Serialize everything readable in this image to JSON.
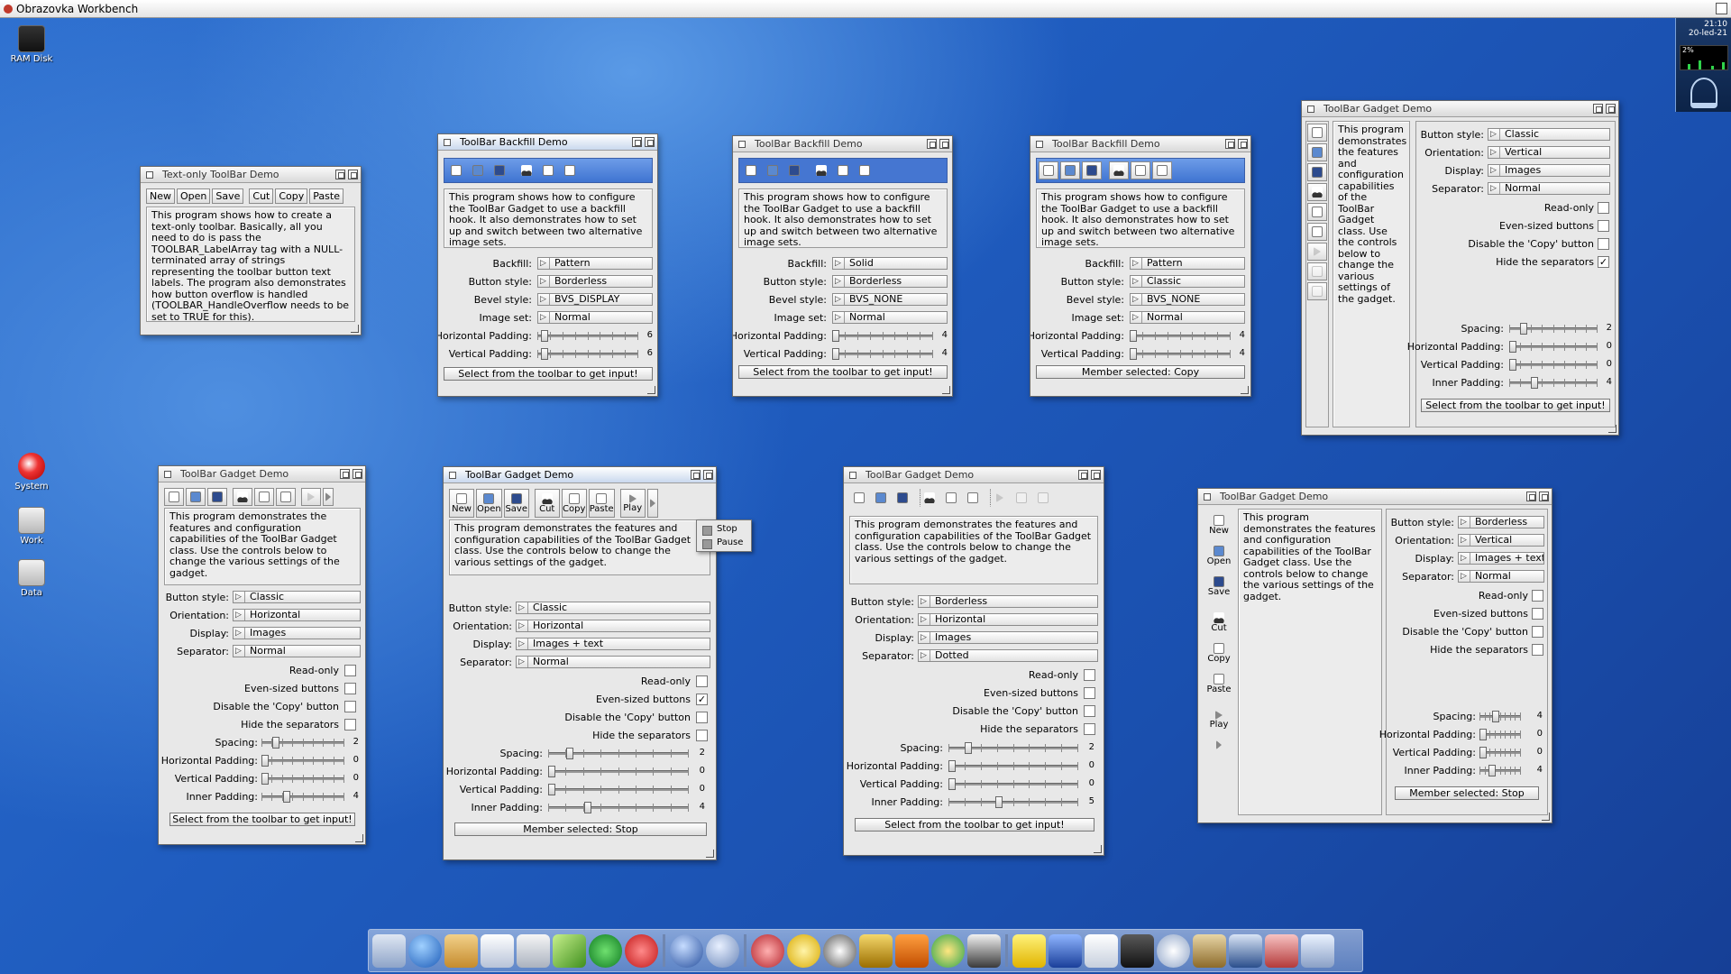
{
  "screen": {
    "title": "Obrazovka Workbench"
  },
  "desktop_icons": [
    "RAM Disk",
    "System",
    "Work",
    "Data"
  ],
  "clock": {
    "time": "21:10",
    "date": "20-led-21",
    "cpu": "2%"
  },
  "colors": {
    "accent": "#4576d1",
    "desktop": "#1f5cbf",
    "window_bg": "#e8e8e8"
  },
  "common": {
    "button_style": "Button style:",
    "orientation": "Orientation:",
    "display": "Display:",
    "separator": "Separator:",
    "read_only": "Read-only",
    "even_sized": "Even-sized buttons",
    "disable_copy": "Disable the 'Copy' button",
    "hide_separators": "Hide the separators",
    "spacing": "Spacing:",
    "hpad": "Horizontal Padding:",
    "vpad": "Vertical Padding:",
    "inner": "Inner Padding:",
    "backfill": "Backfill:",
    "bevel": "Bevel style:",
    "imageset": "Image set:",
    "select_prompt": "Select from the toolbar to get input!",
    "gadget_desc_long": "This program demonstrates the features and configuration capabilities of the ToolBar Gadget class. Use the controls below to change the various settings of the gadget.",
    "backfill_desc": "This program shows how to configure the ToolBar Gadget to use a backfill hook. It also demonstrates how to set up and switch between two alternative image sets."
  },
  "w1": {
    "title": "Text-only ToolBar Demo",
    "buttons": [
      "New",
      "Open",
      "Save",
      "Cut",
      "Copy",
      "Paste"
    ],
    "desc": "This program shows how to create a text-only toolbar. Basically, all you need to do is pass the TOOLBAR_LabelArray tag with a NULL-terminated array of strings representing the toolbar button text labels. The program also demonstrates how button overflow is handled (TOOLBAR_HandleOverflow needs to be set to TRUE for this)."
  },
  "w2": {
    "title": "ToolBar Backfill Demo",
    "backfill": "Pattern",
    "button_style": "Borderless",
    "bevel": "BVS_DISPLAY",
    "imageset": "Normal",
    "hpad": "6",
    "vpad": "6",
    "status": "Select from the toolbar to get input!"
  },
  "w3": {
    "title": "ToolBar Backfill Demo",
    "backfill": "Solid",
    "button_style": "Borderless",
    "bevel": "BVS_NONE",
    "imageset": "Normal",
    "hpad": "4",
    "vpad": "4",
    "status": "Select from the toolbar to get input!"
  },
  "w4": {
    "title": "ToolBar Backfill Demo",
    "backfill": "Pattern",
    "button_style": "Classic",
    "bevel": "BVS_NONE",
    "imageset": "Normal",
    "hpad": "4",
    "vpad": "4",
    "status": "Member selected: Copy"
  },
  "w5": {
    "title": "ToolBar Gadget Demo",
    "button_style": "Classic",
    "orientation": "Vertical",
    "display": "Images",
    "separator": "Normal",
    "spacing": "2",
    "hpad": "0",
    "vpad": "0",
    "inner": "4",
    "status": "Select from the toolbar to get input!"
  },
  "w6": {
    "title": "ToolBar Gadget Demo",
    "button_style": "Classic",
    "orientation": "Horizontal",
    "display": "Images",
    "separator": "Normal",
    "spacing": "2",
    "hpad": "0",
    "vpad": "0",
    "inner": "4",
    "status": "Select from the toolbar to get input!"
  },
  "w7": {
    "title": "ToolBar Gadget Demo",
    "buttons": [
      "New",
      "Open",
      "Save",
      "Cut",
      "Copy",
      "Paste",
      "Play"
    ],
    "menu": [
      "Stop",
      "Pause"
    ],
    "button_style": "Classic",
    "orientation": "Horizontal",
    "display": "Images + text",
    "separator": "Normal",
    "spacing": "2",
    "hpad": "0",
    "vpad": "0",
    "inner": "4",
    "status": "Member selected: Stop"
  },
  "w8": {
    "title": "ToolBar Gadget Demo",
    "button_style": "Borderless",
    "orientation": "Horizontal",
    "display": "Images",
    "separator": "Dotted",
    "spacing": "2",
    "hpad": "0",
    "vpad": "0",
    "inner": "5",
    "status": "Select from the toolbar to get input!"
  },
  "w9": {
    "title": "ToolBar Gadget Demo",
    "buttons": [
      "New",
      "Open",
      "Save",
      "Cut",
      "Copy",
      "Paste",
      "Play"
    ],
    "button_style": "Borderless",
    "orientation": "Vertical",
    "display": "Images + text",
    "separator": "Normal",
    "spacing": "4",
    "hpad": "0",
    "vpad": "0",
    "inner": "4",
    "status": "Member selected: Stop"
  }
}
